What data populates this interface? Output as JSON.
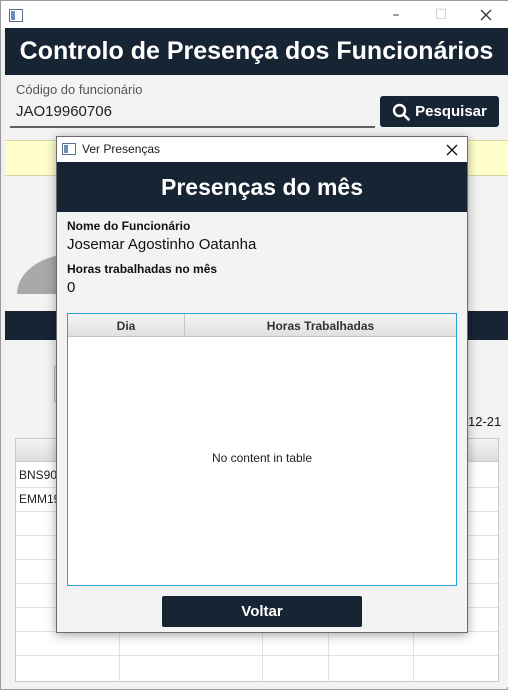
{
  "main_window": {
    "title": "",
    "header": "Controlo de Presença dos Funcionários",
    "code_label": "Código do funcionário",
    "code_value": "JAO19960706",
    "search_label": "Pesquisar",
    "date_fragment": "12-21",
    "table_rows": [
      "BNS909",
      "EMM19"
    ]
  },
  "dialog": {
    "title": "Ver Presenças",
    "header": "Presenças do mês",
    "employee_name_label": "Nome do Funcionário",
    "employee_name": "Josemar Agostinho Oatanha",
    "hours_label": "Horas trabalhadas no mês",
    "hours_value": "0",
    "columns": [
      "Dia",
      "Horas Trabalhadas"
    ],
    "empty_message": "No content in table",
    "back_label": "Voltar"
  },
  "colors": {
    "header_bg": "#172434",
    "table_focus": "#2aa4d4"
  }
}
